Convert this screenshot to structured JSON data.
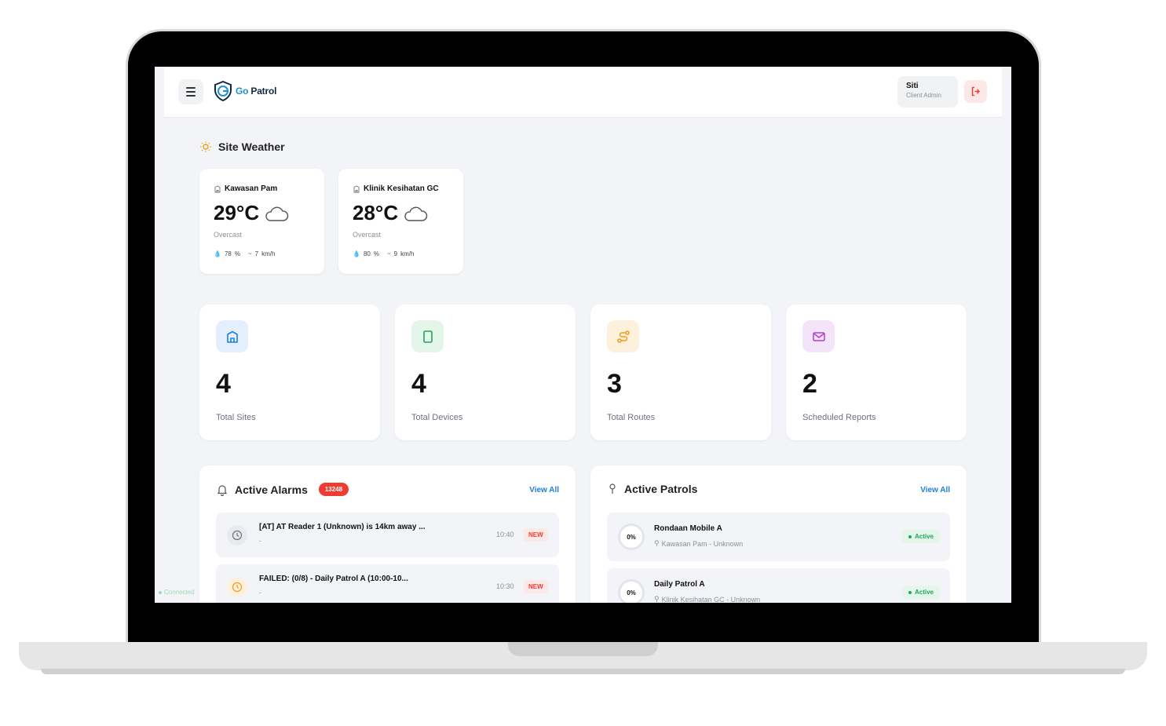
{
  "app": {
    "logo_prefix": "Go",
    "logo_suffix": "Patrol",
    "user_name": "Siti",
    "user_role": "Client Admin"
  },
  "weather": {
    "title": "Site Weather",
    "sites": [
      {
        "name": "Kawasan Pam",
        "temp": "29°C",
        "condition": "Overcast",
        "humidity": "78",
        "humidity_unit": "%",
        "wind": "7",
        "wind_unit": "km/h"
      },
      {
        "name": "Klinik Kesihatan GC",
        "temp": "28°C",
        "condition": "Overcast",
        "humidity": "80",
        "humidity_unit": "%",
        "wind": "9",
        "wind_unit": "km/h"
      }
    ]
  },
  "stats": [
    {
      "value": "4",
      "label": "Total Sites",
      "icon": "building-icon",
      "color": "#1e7fe0",
      "bg": "#e3effd"
    },
    {
      "value": "4",
      "label": "Total Devices",
      "icon": "tablet-icon",
      "color": "#22a55a",
      "bg": "#e4f6ea"
    },
    {
      "value": "3",
      "label": "Total Routes",
      "icon": "route-icon",
      "color": "#f39c12",
      "bg": "#fdf1de"
    },
    {
      "value": "2",
      "label": "Scheduled Reports",
      "icon": "mail-icon",
      "color": "#b23fd6",
      "bg": "#f4e4fa"
    }
  ],
  "alarms": {
    "title": "Active Alarms",
    "count": "13248",
    "view_all": "View All",
    "items": [
      {
        "title": "[AT] AT Reader 1 (Unknown) is 14km away ...",
        "sub": "-",
        "time": "10:40",
        "tag": "NEW",
        "icon": "clock-icon"
      },
      {
        "title": "FAILED: (0/8) - Daily Patrol A (10:00-10...",
        "sub": "-",
        "time": "10:30",
        "tag": "NEW",
        "icon": "clock-icon"
      }
    ]
  },
  "patrols": {
    "title": "Active Patrols",
    "view_all": "View All",
    "items": [
      {
        "progress": "0%",
        "name": "Rondaan Mobile A",
        "location": "Kawasan Pam - Unknown",
        "status": "Active"
      },
      {
        "progress": "0%",
        "name": "Daily Patrol A",
        "location": "Klinik Kesihatan GC - Unknown",
        "status": "Active"
      }
    ]
  },
  "connection": {
    "status": "Connected"
  },
  "colors": {
    "accent": "#1e7fe0",
    "danger": "#ef3b32",
    "success": "#22a55a",
    "screen_bg": "#f3f4f7"
  }
}
